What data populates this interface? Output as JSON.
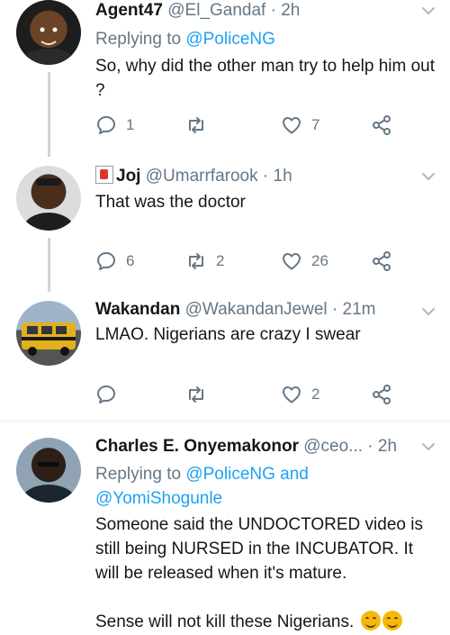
{
  "tweets": [
    {
      "name": "Agent47",
      "handle": "@El_Gandaf",
      "time": "· 2h",
      "replying_prefix": "Replying to",
      "replying_handle": "@PoliceNG",
      "text": "So, why did the other man try to help him out ?",
      "replies": "1",
      "retweets": "",
      "likes": "7"
    },
    {
      "name": "Joj",
      "handle": "@Umarrfarook",
      "time": "· 1h",
      "text": "That was the doctor",
      "replies": "6",
      "retweets": "2",
      "likes": "26"
    },
    {
      "name": "Wakandan",
      "handle": "@WakandanJewel",
      "time": "· 21m",
      "text": "LMAO. Nigerians are crazy I swear",
      "replies": "",
      "retweets": "",
      "likes": "2"
    },
    {
      "name": "Charles E. Onyemakonor",
      "handle": "@ceo...",
      "time": "· 2h",
      "replying_prefix": "Replying to",
      "replying_handle": "@PoliceNG",
      "replying_and": "and",
      "replying_handle2": "@YomiShogunle",
      "text": "Someone said the UNDOCTORED video is still being NURSED in the INCUBATOR. It will be released when it's mature.",
      "text2": "Sense will not kill these Nigerians."
    }
  ],
  "icons": {
    "reply": "reply-icon",
    "retweet": "retweet-icon",
    "like": "heart-icon",
    "share": "share-icon",
    "caret": "chevron-down-icon",
    "emoji": "grinning-face-emoji-icon"
  },
  "colors": {
    "link": "#1da1f2",
    "muted": "#657786",
    "text": "#14171a",
    "thread": "#ccd6dd"
  }
}
